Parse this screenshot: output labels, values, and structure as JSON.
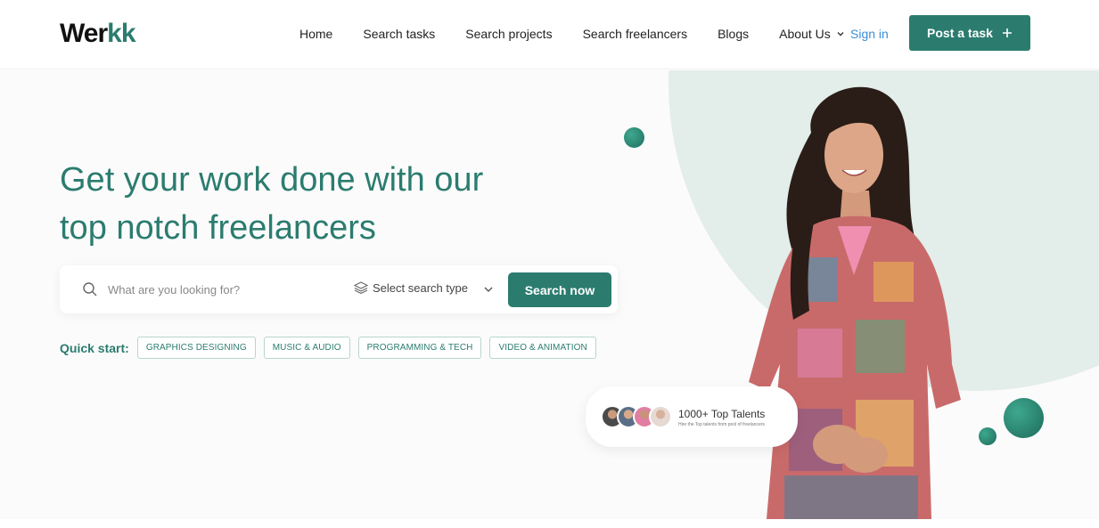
{
  "header": {
    "logo": {
      "main": "Wer",
      "accent": "kk"
    },
    "nav": [
      {
        "label": "Home"
      },
      {
        "label": "Search tasks"
      },
      {
        "label": "Search projects"
      },
      {
        "label": "Search freelancers"
      },
      {
        "label": "Blogs"
      },
      {
        "label": "About Us",
        "icon": "chevron-down-icon"
      }
    ],
    "signin_label": "Sign in",
    "post_task_label": "Post a task",
    "post_task_icon": "plus-icon"
  },
  "hero": {
    "headline_line1": "Get your work done with our",
    "headline_line2": "top notch freelancers",
    "search": {
      "placeholder": "What are you looking for?",
      "type_label": "Select search type",
      "button_label": "Search now"
    },
    "quick_start": {
      "label": "Quick start:",
      "chips": [
        "GRAPHICS DESIGNING",
        "MUSIC & AUDIO",
        "PROGRAMMING & TECH",
        "VIDEO & ANIMATION"
      ]
    },
    "talent_card": {
      "title": "1000+ Top Talents",
      "subtitle": "Hire the Top talents from pool of freelancers"
    }
  },
  "colors": {
    "brand": "#2b7c6f",
    "link": "#3a8fd6",
    "hero_circle": "#e3ede9"
  }
}
